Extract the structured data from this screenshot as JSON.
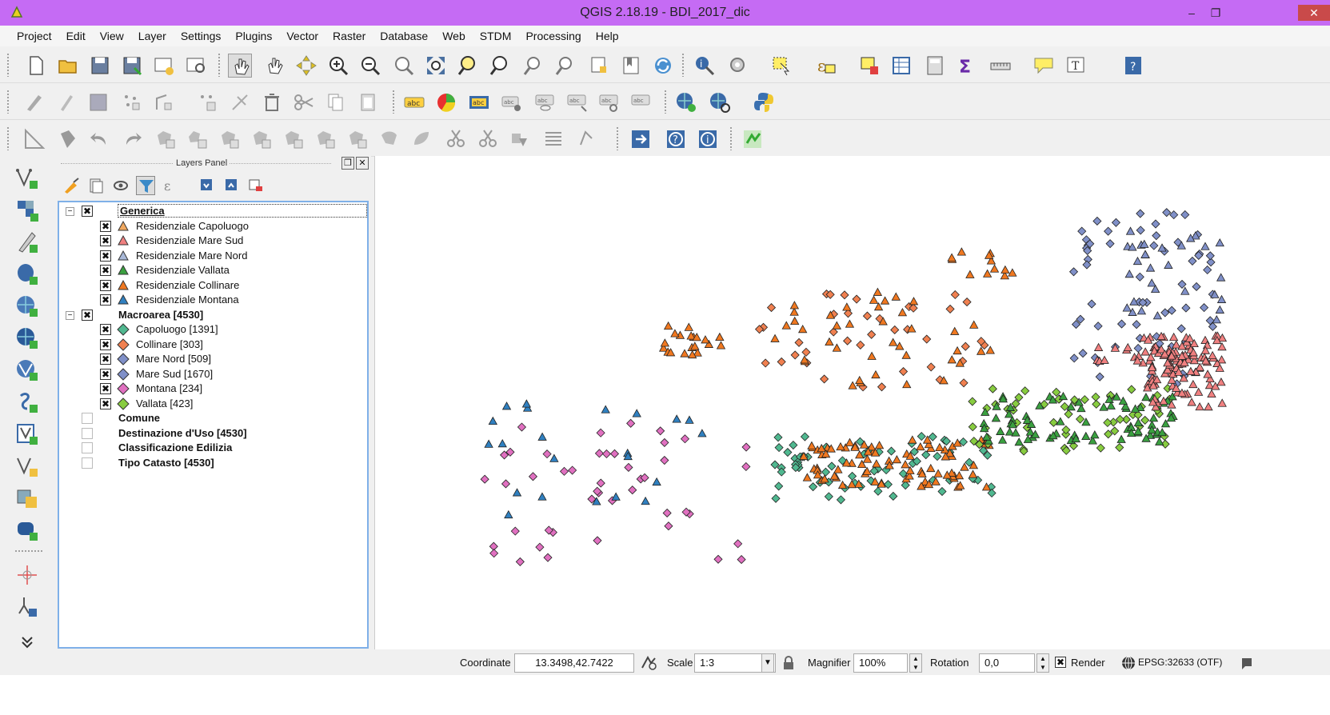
{
  "window": {
    "title": "QGIS 2.18.19 - BDI_2017_dic",
    "minimize": "–",
    "restore": "❐",
    "close": "✕"
  },
  "menu": [
    "Project",
    "Edit",
    "View",
    "Layer",
    "Settings",
    "Plugins",
    "Vector",
    "Raster",
    "Database",
    "Web",
    "STDM",
    "Processing",
    "Help"
  ],
  "layers_panel": {
    "title": "Layers Panel",
    "float_btn": "❐",
    "close_btn": "✕",
    "groups": [
      {
        "name": "Generica",
        "checked": true,
        "expanded": true,
        "items": [
          {
            "label": "Residenziale Capoluogo",
            "symbol": "triangle",
            "color": "#f0a860"
          },
          {
            "label": "Residenziale Mare Sud",
            "symbol": "triangle",
            "color": "#f08080"
          },
          {
            "label": "Residenziale Mare Nord",
            "symbol": "triangle",
            "color": "#a8b8d8"
          },
          {
            "label": "Residenziale Vallata",
            "symbol": "triangle",
            "color": "#3aa040"
          },
          {
            "label": "Residenziale Collinare",
            "symbol": "triangle",
            "color": "#f07820"
          },
          {
            "label": "Residenziale Montana",
            "symbol": "triangle",
            "color": "#3080c0"
          }
        ]
      },
      {
        "name": "Macroarea [4530]",
        "checked": true,
        "expanded": true,
        "items": [
          {
            "label": "Capoluogo [1391]",
            "symbol": "diamond",
            "color": "#50b890"
          },
          {
            "label": "Collinare [303]",
            "symbol": "diamond",
            "color": "#f08050"
          },
          {
            "label": "Mare Nord [509]",
            "symbol": "diamond",
            "color": "#8090c8"
          },
          {
            "label": "Mare Sud [1670]",
            "symbol": "diamond",
            "color": "#8090c8"
          },
          {
            "label": "Montana [234]",
            "symbol": "diamond",
            "color": "#e070c0"
          },
          {
            "label": "Vallata [423]",
            "symbol": "diamond",
            "color": "#88cc40"
          }
        ]
      },
      {
        "name": "Comune",
        "checked": false,
        "expanded": false,
        "items": []
      },
      {
        "name": "Destinazione d'Uso [4530]",
        "checked": false,
        "expanded": false,
        "items": []
      },
      {
        "name": "Classificazione Edilizia",
        "checked": false,
        "expanded": false,
        "items": []
      },
      {
        "name": "Tipo Catasto [4530]",
        "checked": false,
        "expanded": false,
        "items": []
      }
    ]
  },
  "status": {
    "coordinate_label": "Coordinate",
    "coordinate_value": "13.3498,42.7422",
    "scale_label": "Scale",
    "scale_value": "1:3",
    "magnifier_label": "Magnifier",
    "magnifier_value": "100%",
    "rotation_label": "Rotation",
    "rotation_value": "0,0",
    "render_label": "Render",
    "render_checked": true,
    "crs": "EPSG:32633 (OTF)"
  },
  "colors": {
    "title_bar": "#c56bf4",
    "capoluogo": "#50b890",
    "collinare": "#f08050",
    "mare": "#8090c8",
    "montana": "#e070c0",
    "vallata": "#88cc40",
    "orange_tri": "#f07820",
    "salmon_tri": "#f08080",
    "blue_tri": "#3080c0",
    "green_tri": "#3aa040"
  }
}
